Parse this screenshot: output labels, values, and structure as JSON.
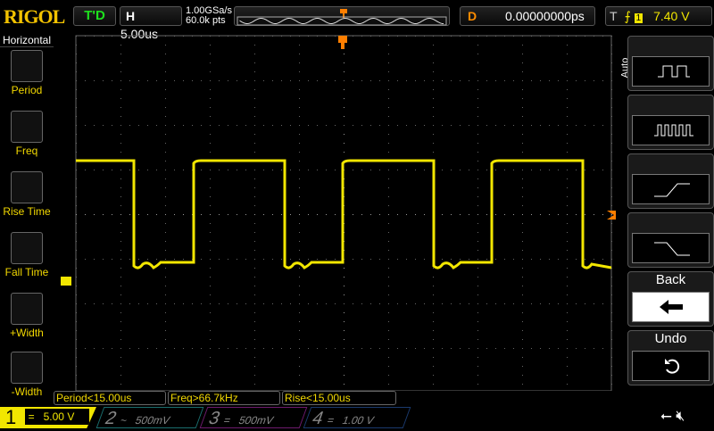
{
  "brand": "RIGOL",
  "status": "T'D",
  "horizontal": {
    "label": "H",
    "timebase": "5.00us",
    "sample_rate": "1.00GSa/s",
    "memory": "60.0k pts"
  },
  "delay": {
    "label": "D",
    "value": "0.00000000ps"
  },
  "trigger": {
    "label": "T",
    "slope": "rising-edge-icon",
    "source": "1",
    "level": "7.40 V"
  },
  "left_menu": {
    "title": "Horizontal",
    "items": [
      {
        "label": "Period"
      },
      {
        "label": "Freq"
      },
      {
        "label": "Rise Time"
      },
      {
        "label": "Fall Time"
      },
      {
        "label": "+Width"
      },
      {
        "label": "-Width"
      }
    ]
  },
  "right_menu": {
    "auto_label": "Auto",
    "items": [
      {
        "icon": "square-wave-icon"
      },
      {
        "icon": "pulse-train-icon"
      },
      {
        "icon": "rising-edge-icon"
      },
      {
        "icon": "falling-edge-icon"
      },
      {
        "label": "Back",
        "icon": "arrow-left-icon"
      },
      {
        "label": "Undo",
        "icon": "undo-icon"
      }
    ]
  },
  "measurements": [
    "Period<15.00us",
    "Freq>66.7kHz",
    "Rise<15.00us"
  ],
  "channels": [
    {
      "num": "1",
      "coupling": "=",
      "scale": "5.00 V",
      "color": "#f2e600",
      "active": true
    },
    {
      "num": "2",
      "coupling": "~",
      "scale": "500mV",
      "color": "#1a6e6e",
      "active": false
    },
    {
      "num": "3",
      "coupling": "=",
      "scale": "500mV",
      "color": "#6e1a6e",
      "active": false
    },
    {
      "num": "4",
      "coupling": "=",
      "scale": "1.00 V",
      "color": "#1a3a6e",
      "active": false
    }
  ],
  "colors": {
    "trace": "#f2e600",
    "trigger_marker": "#ff7f00",
    "grid": "#555555"
  }
}
